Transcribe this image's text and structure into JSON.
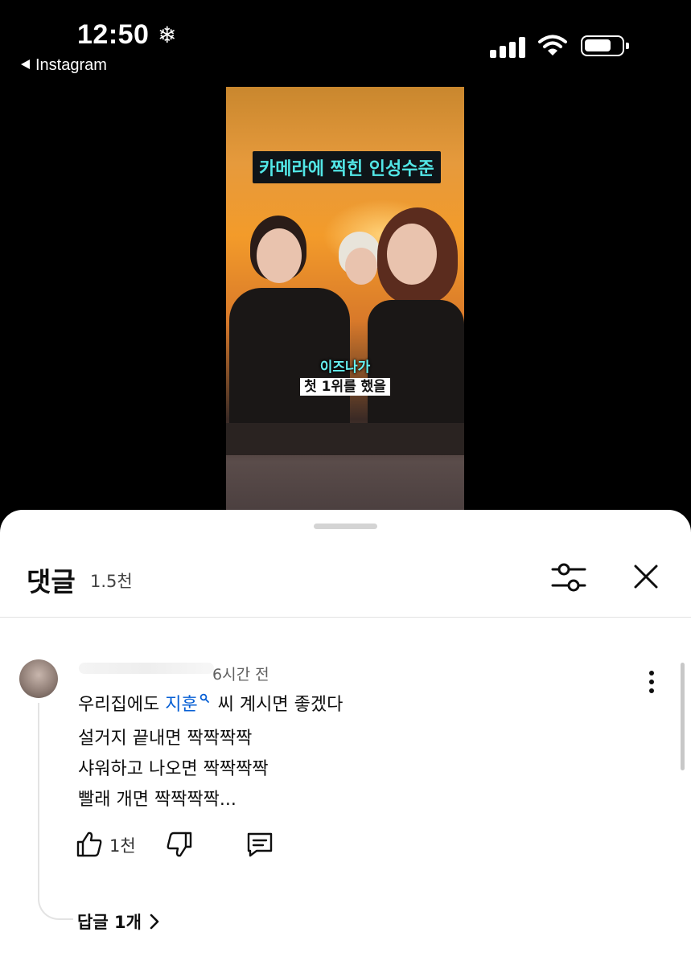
{
  "status_bar": {
    "time": "12:50",
    "weather_glyph": "❄",
    "back_label": "Instagram"
  },
  "video": {
    "top_caption": "카메라에 찍힌 인성수준",
    "mid_caption_1": "이즈나가",
    "mid_caption_2": "첫 1위를 했을"
  },
  "sheet": {
    "title": "댓글",
    "count": "1.5천"
  },
  "comment": {
    "time": "6시간 전",
    "line1_before": "우리집에도 ",
    "line1_mention": "지훈",
    "line1_after": " 씨 계시면 좋겠다",
    "line2": "설거지 끝내면 짝짝짝짝",
    "line3": "샤워하고 나오면 짝짝짝짝",
    "line4": "빨래 개면 짝짝짝짝...",
    "like_count": "1천",
    "replies_label": "답글 1개"
  },
  "colors": {
    "mention": "#065fd4",
    "caption_cyan": "#52e6e6"
  },
  "icons": [
    "snowflake-icon",
    "back-triangle-icon",
    "signal-icon",
    "wifi-icon",
    "battery-icon",
    "filter-icon",
    "close-icon",
    "more-vert-icon",
    "thumb-up-icon",
    "thumb-down-icon",
    "reply-icon",
    "chevron-right-icon",
    "search-icon"
  ]
}
